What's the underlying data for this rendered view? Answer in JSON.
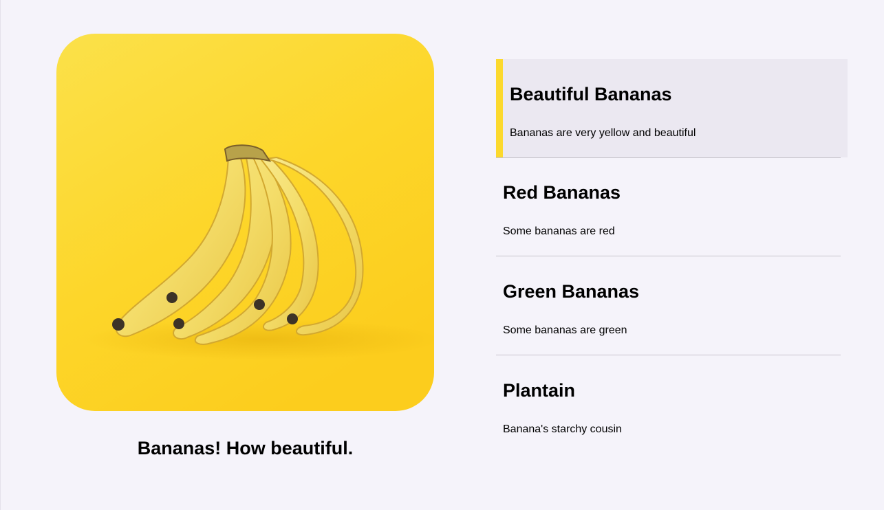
{
  "hero": {
    "image_alt": "Bunch of yellow bananas on a yellow background",
    "caption": "Bananas! How beautiful."
  },
  "items": [
    {
      "title": "Beautiful Bananas",
      "description": "Bananas are very yellow and beautiful",
      "active": true
    },
    {
      "title": "Red Bananas",
      "description": "Some bananas are red",
      "active": false
    },
    {
      "title": "Green Bananas",
      "description": "Some bananas are green",
      "active": false
    },
    {
      "title": "Plantain",
      "description": "Banana's starchy cousin",
      "active": false
    }
  ],
  "colors": {
    "accent": "#fcd92d",
    "background": "#f5f3fa",
    "active_item_bg": "#ebe8f1",
    "divider": "#c6c3cb"
  }
}
